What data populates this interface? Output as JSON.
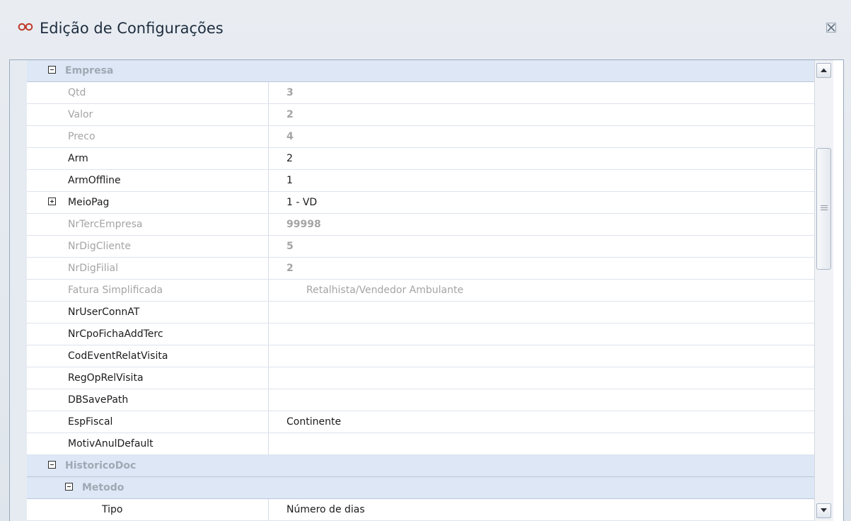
{
  "window": {
    "title": "Edição de Configurações",
    "app_icon": "infinity-icon",
    "close_icon": "close-icon",
    "accent_color": "#c0392b"
  },
  "grid": {
    "rows": [
      {
        "type": "category",
        "name": "Empresa",
        "indent": 0,
        "expanded": true
      },
      {
        "type": "property",
        "name": "Qtd",
        "value": "3",
        "disabled": true
      },
      {
        "type": "property",
        "name": "Valor",
        "value": "2",
        "disabled": true
      },
      {
        "type": "property",
        "name": "Preco",
        "value": "4",
        "disabled": true
      },
      {
        "type": "property",
        "name": "Arm",
        "value": "2",
        "disabled": false
      },
      {
        "type": "property",
        "name": "ArmOffline",
        "value": "1",
        "disabled": false
      },
      {
        "type": "property",
        "name": "MeioPag",
        "value": "1 - VD",
        "disabled": false,
        "expandable": true
      },
      {
        "type": "property",
        "name": "NrTercEmpresa",
        "value": "99998",
        "disabled": true
      },
      {
        "type": "property",
        "name": "NrDigCliente",
        "value": "5",
        "disabled": true
      },
      {
        "type": "property",
        "name": "NrDigFilial",
        "value": "2",
        "disabled": true
      },
      {
        "type": "property",
        "name": "Fatura Simplificada",
        "value": "Retalhista/Vendedor Ambulante",
        "disabled": true,
        "light": true
      },
      {
        "type": "property",
        "name": "NrUserConnAT",
        "value": "",
        "disabled": false
      },
      {
        "type": "property",
        "name": "NrCpoFichaAddTerc",
        "value": "",
        "disabled": false
      },
      {
        "type": "property",
        "name": "CodEventRelatVisita",
        "value": "",
        "disabled": false
      },
      {
        "type": "property",
        "name": "RegOpRelVisita",
        "value": "",
        "disabled": false
      },
      {
        "type": "property",
        "name": "DBSavePath",
        "value": "",
        "disabled": false
      },
      {
        "type": "property",
        "name": "EspFiscal",
        "value": "Continente",
        "disabled": false
      },
      {
        "type": "property",
        "name": "MotivAnulDefault",
        "value": "",
        "disabled": false
      },
      {
        "type": "category",
        "name": "HistoricoDoc",
        "indent": 0,
        "expanded": true
      },
      {
        "type": "category",
        "name": "Metodo",
        "indent": 1,
        "expanded": true
      },
      {
        "type": "property",
        "name": "Tipo",
        "value": "Número de dias",
        "disabled": false,
        "indent": 2
      }
    ]
  },
  "scrollbar": {
    "up_icon": "arrow-up-icon",
    "down_icon": "arrow-down-icon",
    "position_fraction": 0.23
  }
}
